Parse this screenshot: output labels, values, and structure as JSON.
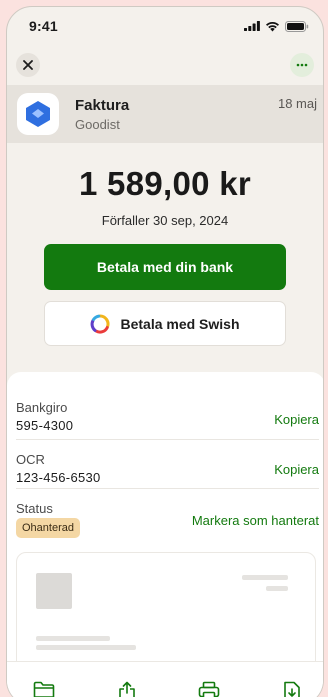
{
  "status_bar": {
    "time": "9:41"
  },
  "topbar": {
    "close_icon": "close-icon",
    "more_icon": "more-icon"
  },
  "sender": {
    "name": "Faktura",
    "subtitle": "Goodist",
    "date": "18 maj"
  },
  "invoice": {
    "amount": "1 589,00 kr",
    "due": "Förfaller 30 sep, 2024"
  },
  "actions": {
    "pay_bank": "Betala med din bank",
    "pay_swish": "Betala med Swish"
  },
  "details": [
    {
      "label": "Bankgiro",
      "value": "595-4300",
      "action": "Kopiera"
    },
    {
      "label": "OCR",
      "value": "123-456-6530",
      "action": "Kopiera"
    },
    {
      "label": "Status",
      "badge": "Ohanterad",
      "action": "Markera som hanterat"
    }
  ],
  "bottom_bar": [
    "folder-icon",
    "share-icon",
    "print-icon",
    "download-file-icon"
  ],
  "colors": {
    "accent": "#137a0f",
    "badge": "#f4d7a4",
    "background": "#fbe2df"
  }
}
